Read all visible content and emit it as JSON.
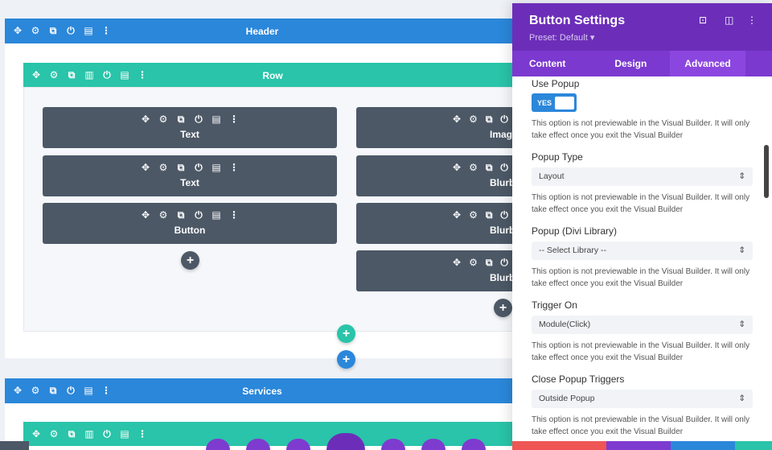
{
  "sections": [
    {
      "title": "Header",
      "color": "#2b87da"
    },
    {
      "title": "Services",
      "color": "#2b87da"
    }
  ],
  "row": {
    "title": "Row",
    "color": "#29c4a9"
  },
  "section_tools": [
    "move-icon",
    "gear-icon",
    "duplicate-icon",
    "power-icon",
    "trash-icon",
    "more-icon"
  ],
  "row_tools": [
    "move-icon",
    "gear-icon",
    "duplicate-icon",
    "columns-icon",
    "power-icon",
    "trash-icon",
    "more-icon"
  ],
  "modules": {
    "col1": [
      "Text",
      "Text",
      "Button"
    ],
    "col2": [
      "Image",
      "Blurb",
      "Blurb",
      "Blurb"
    ]
  },
  "panel": {
    "title": "Button Settings",
    "preset": "Preset: Default ▾",
    "tabs": [
      "Content",
      "Design",
      "Advanced"
    ],
    "active_tab": "Advanced",
    "use_popup_label": "Use Popup",
    "toggle": "YES",
    "note": "This option is not previewable in the Visual Builder. It will only take effect once you exit the Visual Builder",
    "fields": [
      {
        "label": "Popup Type",
        "value": "Layout"
      },
      {
        "label": "Popup (Divi Library)",
        "value": "-- Select Library --"
      },
      {
        "label": "Trigger On",
        "value": "Module(Click)"
      },
      {
        "label": "Close Popup Triggers",
        "value": "Outside Popup"
      }
    ]
  },
  "colors": {
    "section": "#2b87da",
    "row": "#29c4a9",
    "module": "#4c5866",
    "panel": "#6c2eb9"
  }
}
